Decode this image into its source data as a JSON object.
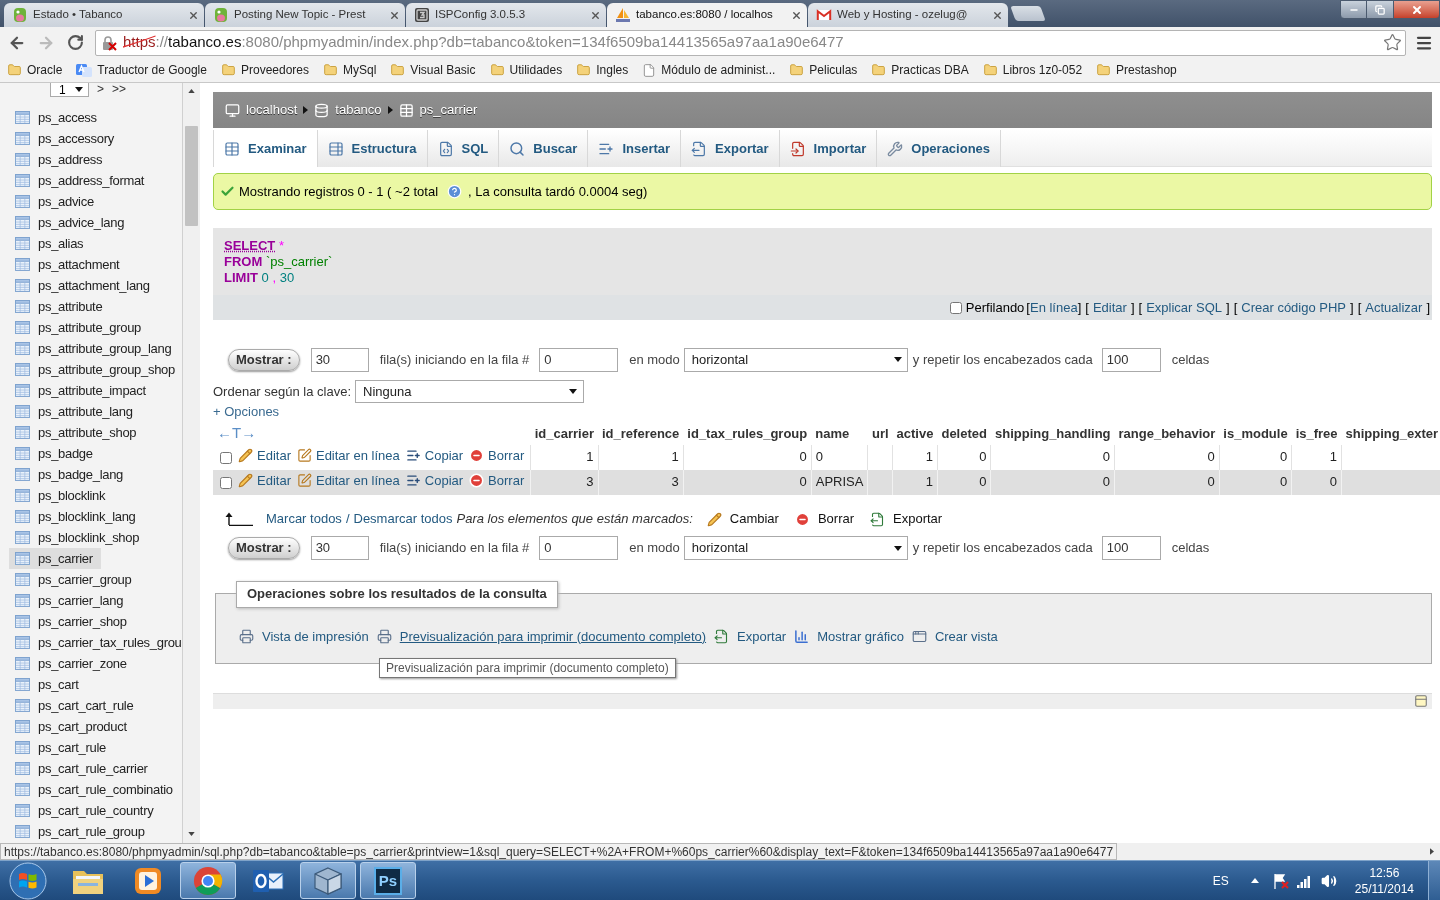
{
  "browser": {
    "tabs": [
      {
        "title": "Estado • Tabanco",
        "kind": "prestashop",
        "selected": false
      },
      {
        "title": "Posting New Topic - Prest",
        "kind": "prestashop",
        "selected": false
      },
      {
        "title": "ISPConfig 3.0.5.3",
        "kind": "ispconfig",
        "selected": false
      },
      {
        "title": "tabanco.es:8080 / localhos",
        "kind": "phpmyadmin",
        "selected": true
      },
      {
        "title": "Web y Hosting - ozelug@",
        "kind": "gmail",
        "selected": false
      }
    ],
    "address": {
      "insecure": true,
      "scheme": "https",
      "separator": "://",
      "host": "tabanco.es",
      "rest": ":8080/phpmyadmin/index.php?db=tabanco&token=134f6509ba14413565a97aa1a90e6477"
    },
    "bookmarks": [
      {
        "label": "Oracle",
        "kind": "folder"
      },
      {
        "label": "Traductor de Google",
        "kind": "app"
      },
      {
        "label": "Proveedores",
        "kind": "folder"
      },
      {
        "label": "MySql",
        "kind": "folder"
      },
      {
        "label": "Visual Basic",
        "kind": "folder"
      },
      {
        "label": "Utilidades",
        "kind": "folder"
      },
      {
        "label": "Ingles",
        "kind": "folder"
      },
      {
        "label": "Módulo de administ...",
        "kind": "page"
      },
      {
        "label": "Peliculas",
        "kind": "folder"
      },
      {
        "label": "Practicas DBA",
        "kind": "folder"
      },
      {
        "label": "Libros 1z0-052",
        "kind": "folder"
      },
      {
        "label": "Prestashop",
        "kind": "folder"
      }
    ]
  },
  "sidebar": {
    "page": "1",
    "next": ">",
    "last": ">>",
    "tables": [
      {
        "name": "ps_access",
        "selected": false
      },
      {
        "name": "ps_accessory",
        "selected": false
      },
      {
        "name": "ps_address",
        "selected": false
      },
      {
        "name": "ps_address_format",
        "selected": false
      },
      {
        "name": "ps_advice",
        "selected": false
      },
      {
        "name": "ps_advice_lang",
        "selected": false
      },
      {
        "name": "ps_alias",
        "selected": false
      },
      {
        "name": "ps_attachment",
        "selected": false
      },
      {
        "name": "ps_attachment_lang",
        "selected": false
      },
      {
        "name": "ps_attribute",
        "selected": false
      },
      {
        "name": "ps_attribute_group",
        "selected": false
      },
      {
        "name": "ps_attribute_group_lang",
        "selected": false
      },
      {
        "name": "ps_attribute_group_shop",
        "selected": false
      },
      {
        "name": "ps_attribute_impact",
        "selected": false
      },
      {
        "name": "ps_attribute_lang",
        "selected": false
      },
      {
        "name": "ps_attribute_shop",
        "selected": false
      },
      {
        "name": "ps_badge",
        "selected": false
      },
      {
        "name": "ps_badge_lang",
        "selected": false
      },
      {
        "name": "ps_blocklink",
        "selected": false
      },
      {
        "name": "ps_blocklink_lang",
        "selected": false
      },
      {
        "name": "ps_blocklink_shop",
        "selected": false
      },
      {
        "name": "ps_carrier",
        "selected": true
      },
      {
        "name": "ps_carrier_group",
        "selected": false
      },
      {
        "name": "ps_carrier_lang",
        "selected": false
      },
      {
        "name": "ps_carrier_shop",
        "selected": false
      },
      {
        "name": "ps_carrier_tax_rules_grou",
        "selected": false
      },
      {
        "name": "ps_carrier_zone",
        "selected": false
      },
      {
        "name": "ps_cart",
        "selected": false
      },
      {
        "name": "ps_cart_cart_rule",
        "selected": false
      },
      {
        "name": "ps_cart_product",
        "selected": false
      },
      {
        "name": "ps_cart_rule",
        "selected": false
      },
      {
        "name": "ps_cart_rule_carrier",
        "selected": false
      },
      {
        "name": "ps_cart_rule_combinatio",
        "selected": false
      },
      {
        "name": "ps_cart_rule_country",
        "selected": false
      },
      {
        "name": "ps_cart_rule_group",
        "selected": false
      }
    ]
  },
  "breadcrumb": [
    {
      "kind": "server",
      "label": "localhost"
    },
    {
      "kind": "database",
      "label": "tabanco"
    },
    {
      "kind": "table",
      "label": "ps_carrier"
    }
  ],
  "tabs": [
    {
      "kind": "browse",
      "label": "Examinar",
      "selected": true
    },
    {
      "kind": "structure",
      "label": "Estructura",
      "selected": false
    },
    {
      "kind": "sql",
      "label": "SQL",
      "selected": false
    },
    {
      "kind": "search",
      "label": "Buscar",
      "selected": false
    },
    {
      "kind": "insert",
      "label": "Insertar",
      "selected": false
    },
    {
      "kind": "export",
      "label": "Exportar",
      "selected": false
    },
    {
      "kind": "import",
      "label": "Importar",
      "selected": false
    },
    {
      "kind": "operations",
      "label": "Operaciones",
      "selected": false
    }
  ],
  "message": {
    "summary": "Mostrando registros 0 - 1 ( ~2 total",
    "query_time": ", La consulta tardó 0.0004 seg)"
  },
  "sql": {
    "lines": [
      [
        {
          "kind": "keyword",
          "text": "SELECT"
        },
        {
          "kind": "operator",
          "text": "*"
        }
      ],
      [
        {
          "kind": "keyword",
          "text": "FROM"
        },
        {
          "kind": "identifier",
          "text": "`ps_carrier`"
        }
      ],
      [
        {
          "kind": "keyword",
          "text": "LIMIT"
        },
        {
          "kind": "number",
          "text": "0"
        },
        {
          "kind": "punctuation",
          "text": ","
        },
        {
          "kind": "number",
          "text": "30"
        }
      ]
    ],
    "profiling": {
      "label": "Perfilando",
      "checked": false
    },
    "links": [
      {
        "open": "[",
        "label": "En línea",
        "close": "]"
      },
      {
        "open": "[",
        "label": "Editar",
        "close": "]"
      },
      {
        "open": "[",
        "label": "Explicar SQL",
        "close": "]"
      },
      {
        "open": "[",
        "label": "Crear código PHP",
        "close": "]"
      },
      {
        "open": "[",
        "label": "Actualizar",
        "close": "]"
      }
    ]
  },
  "navigation": [
    {
      "button": "Mostrar :",
      "rows": "30",
      "rows_label": "fila(s) iniciando en la fila #",
      "start": "0",
      "mode_label": "en modo",
      "mode": "horizontal",
      "repeat_label": "y repetir los encabezados cada",
      "repeat": "100",
      "repeat_unit": "celdas"
    }
  ],
  "sort": {
    "label": "Ordenar según la clave:",
    "value": "Ninguna"
  },
  "options": "+ Opciones",
  "table": {
    "toggle": "←T→",
    "columns": [
      {
        "label": "id_carrier",
        "kind": "number"
      },
      {
        "label": "id_reference",
        "kind": "number"
      },
      {
        "label": "id_tax_rules_group",
        "kind": "number"
      },
      {
        "label": "name",
        "kind": "text"
      },
      {
        "label": "url",
        "kind": "blank"
      },
      {
        "label": "active",
        "kind": "number"
      },
      {
        "label": "deleted",
        "kind": "number"
      },
      {
        "label": "shipping_handling",
        "kind": "number"
      },
      {
        "label": "range_behavior",
        "kind": "number"
      },
      {
        "label": "is_module",
        "kind": "number"
      },
      {
        "label": "is_free",
        "kind": "number"
      },
      {
        "label": "shipping_exter",
        "kind": "blank"
      }
    ],
    "rows": [
      {
        "checked": false,
        "actions": [
          {
            "kind": "edit",
            "label": "Editar"
          },
          {
            "kind": "inline_edit",
            "label": "Editar en línea"
          },
          {
            "kind": "copy",
            "label": "Copiar"
          },
          {
            "kind": "delete",
            "label": "Borrar"
          }
        ],
        "values": [
          "1",
          "1",
          "0",
          "0",
          "1",
          "0",
          "0",
          "0",
          "0",
          "1"
        ]
      },
      {
        "checked": false,
        "actions": [
          {
            "kind": "edit",
            "label": "Editar"
          },
          {
            "kind": "inline_edit",
            "label": "Editar en línea"
          },
          {
            "kind": "copy",
            "label": "Copiar"
          },
          {
            "kind": "delete",
            "label": "Borrar"
          }
        ],
        "values": [
          "3",
          "3",
          "0",
          "APRISA",
          "1",
          "0",
          "0",
          "0",
          "0",
          "0"
        ]
      }
    ]
  },
  "bulk": {
    "mark_all": "Marcar todos",
    "divider": "/",
    "unmark_all": "Desmarcar todos",
    "with_selected": "Para los elementos que están marcados:",
    "actions": [
      {
        "kind": "edit",
        "label": "Cambiar"
      },
      {
        "kind": "delete",
        "label": "Borrar"
      },
      {
        "kind": "export",
        "label": "Exportar"
      }
    ]
  },
  "navigation_bottom": {
    "button": "Mostrar :",
    "rows": "30",
    "rows_label": "fila(s) iniciando en la fila #",
    "start": "0",
    "mode_label": "en modo",
    "mode": "horizontal",
    "repeat_label": "y repetir los encabezados cada",
    "repeat": "100",
    "repeat_unit": "celdas"
  },
  "operations": {
    "legend": "Operaciones sobre los resultados de la consulta",
    "links": [
      {
        "kind": "print",
        "label": "Vista de impresión",
        "hovered": false
      },
      {
        "kind": "print",
        "label": "Previsualización para imprimir (documento completo)",
        "hovered": true
      },
      {
        "kind": "export",
        "label": "Exportar",
        "hovered": false
      },
      {
        "kind": "chart",
        "label": "Mostrar gráfico",
        "hovered": false
      },
      {
        "kind": "view",
        "label": "Crear vista",
        "hovered": false
      }
    ],
    "tooltip": "Previsualización para imprimir (documento completo)"
  },
  "status_url": "https://tabanco.es:8080/phpmyadmin/sql.php?db=tabanco&table=ps_carrier&printview=1&sql_query=SELECT+%2A+FROM+%60ps_carrier%60&display_text=F&token=134f6509ba14413565a97aa1a90e6477",
  "taskbar": {
    "apps": [
      {
        "kind": "explorer",
        "running": false
      },
      {
        "kind": "media_player",
        "running": false
      },
      {
        "kind": "chrome",
        "running": true
      },
      {
        "kind": "outlook",
        "running": false
      },
      {
        "kind": "virtualbox",
        "running": true
      },
      {
        "kind": "photoshop",
        "running": true,
        "text": "Ps"
      }
    ],
    "language": "ES",
    "time": "12:56",
    "date": "25/11/2014"
  }
}
